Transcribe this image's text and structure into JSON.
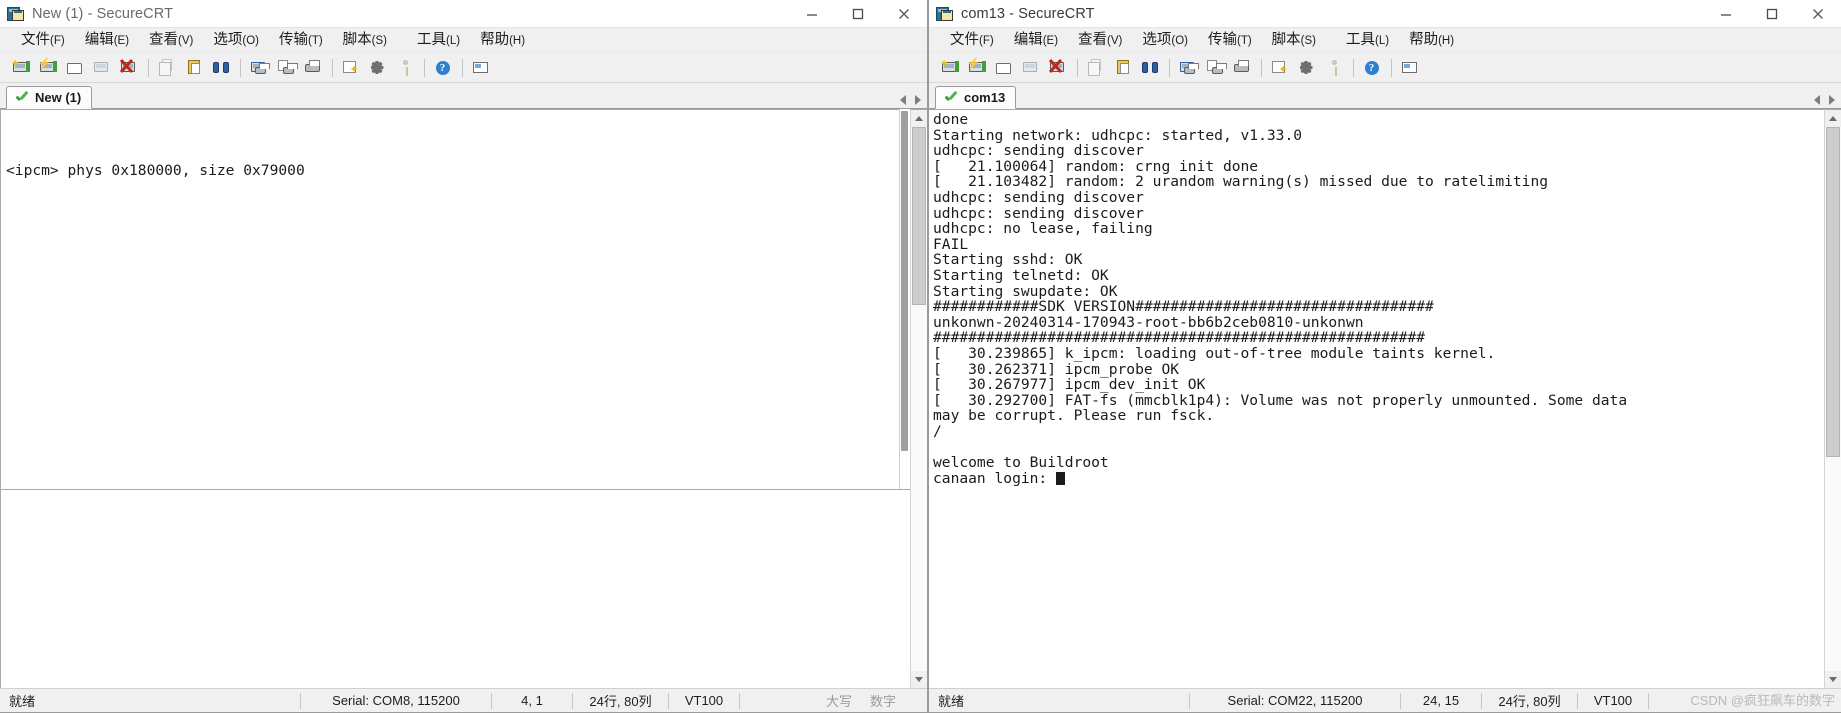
{
  "left_window": {
    "title": "New (1) - SecureCRT",
    "icon": "securecrt-app-icon",
    "controls": {
      "minimize": "minimize",
      "maximize": "maximize",
      "close": "close"
    },
    "menu": [
      {
        "label": "文件",
        "mnemonic": "(F)"
      },
      {
        "label": "编辑",
        "mnemonic": "(E)"
      },
      {
        "label": "查看",
        "mnemonic": "(V)"
      },
      {
        "label": "选项",
        "mnemonic": "(O)"
      },
      {
        "label": "传输",
        "mnemonic": "(T)"
      },
      {
        "label": "脚本",
        "mnemonic": "(S)"
      },
      {
        "label": "工具",
        "mnemonic": "(L)"
      },
      {
        "label": "帮助",
        "mnemonic": "(H)"
      }
    ],
    "tab": {
      "label": "New (1)",
      "status_icon": "green-check-icon"
    },
    "terminal_lines": [
      "<ipcm> phys 0x180000, size 0x79000"
    ],
    "statusbar": {
      "ready": "就绪",
      "serial": "Serial: COM8, 115200",
      "cursor": "4,  1",
      "screen": "24行, 80列",
      "emulation": "VT100",
      "caps": "大写",
      "num": "数字"
    }
  },
  "right_window": {
    "title": "com13 - SecureCRT",
    "icon": "securecrt-app-icon",
    "controls": {
      "minimize": "minimize",
      "maximize": "maximize",
      "close": "close"
    },
    "menu": [
      {
        "label": "文件",
        "mnemonic": "(F)"
      },
      {
        "label": "编辑",
        "mnemonic": "(E)"
      },
      {
        "label": "查看",
        "mnemonic": "(V)"
      },
      {
        "label": "选项",
        "mnemonic": "(O)"
      },
      {
        "label": "传输",
        "mnemonic": "(T)"
      },
      {
        "label": "脚本",
        "mnemonic": "(S)"
      },
      {
        "label": "工具",
        "mnemonic": "(L)"
      },
      {
        "label": "帮助",
        "mnemonic": "(H)"
      }
    ],
    "tab": {
      "label": "com13",
      "status_icon": "green-check-icon"
    },
    "terminal_lines": [
      "done",
      "Starting network: udhcpc: started, v1.33.0",
      "udhcpc: sending discover",
      "[   21.100064] random: crng init done",
      "[   21.103482] random: 2 urandom warning(s) missed due to ratelimiting",
      "udhcpc: sending discover",
      "udhcpc: sending discover",
      "udhcpc: no lease, failing",
      "FAIL",
      "Starting sshd: OK",
      "Starting telnetd: OK",
      "Starting swupdate: OK",
      "############SDK VERSION##################################",
      "unkonwn-20240314-170943-root-bb6b2ceb0810-unkonwn",
      "########################################################",
      "[   30.239865] k_ipcm: loading out-of-tree module taints kernel.",
      "[   30.262371] ipcm_probe OK",
      "[   30.267977] ipcm_dev_init OK",
      "[   30.292700] FAT-fs (mmcblk1p4): Volume was not properly unmounted. Some data",
      "may be corrupt. Please run fsck.",
      "/",
      "",
      "welcome to Buildroot",
      "canaan login: "
    ],
    "statusbar": {
      "ready": "就绪",
      "serial": "Serial: COM22, 115200",
      "cursor": "24,  15",
      "screen": "24行, 80列",
      "emulation": "VT100"
    }
  },
  "toolbar": {
    "buttons": [
      {
        "name": "new-session",
        "icon": "new-session-icon",
        "disabled": false
      },
      {
        "name": "connect-session",
        "icon": "connect-session-icon",
        "disabled": false
      },
      {
        "name": "quick-connect",
        "icon": "quick-connect-icon",
        "disabled": false
      },
      {
        "name": "reconnect",
        "icon": "reconnect-icon",
        "disabled": true
      },
      {
        "name": "disconnect",
        "icon": "disconnect-icon",
        "disabled": false
      },
      {
        "name": "copy",
        "icon": "copy-icon",
        "disabled": true
      },
      {
        "name": "paste",
        "icon": "paste-icon",
        "disabled": false
      },
      {
        "name": "find",
        "icon": "find-binoculars-icon",
        "disabled": false
      },
      {
        "name": "print-screen",
        "icon": "print-screen-icon",
        "disabled": false
      },
      {
        "name": "log-session",
        "icon": "log-session-icon",
        "disabled": false
      },
      {
        "name": "print",
        "icon": "printer-icon",
        "disabled": false
      },
      {
        "name": "session-options",
        "icon": "session-options-icon",
        "disabled": false
      },
      {
        "name": "global-options",
        "icon": "global-options-gear-icon",
        "disabled": false
      },
      {
        "name": "key-manager",
        "icon": "key-icon",
        "disabled": true
      },
      {
        "name": "help",
        "icon": "help-question-icon",
        "disabled": false
      },
      {
        "name": "view-image",
        "icon": "view-image-icon",
        "disabled": false
      }
    ]
  },
  "watermark": "CSDN @疯狂飙车的数字"
}
